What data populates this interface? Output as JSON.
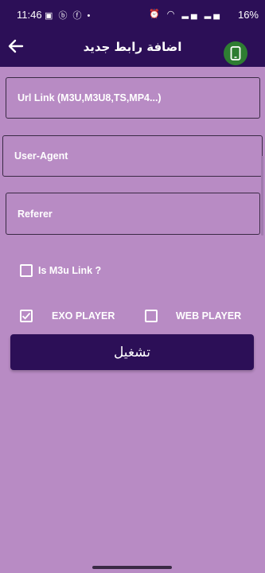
{
  "status_bar": {
    "time": "11:46",
    "battery": "16%",
    "left_icons": [
      "screenshot-icon",
      "b-icon",
      "facebook-icon",
      "dot-icon"
    ],
    "right_icons": [
      "alarm-icon",
      "wifi-icon",
      "signal-icon",
      "signal-icon"
    ]
  },
  "app_bar": {
    "title": "اضافة رابط جديد"
  },
  "form": {
    "url_placeholder": "Url Link (M3U,M3U8,TS,MP4...)",
    "user_agent_placeholder": "User-Agent",
    "referer_placeholder": "Referer",
    "is_m3u_label": "Is M3u Link ?",
    "is_m3u_checked": false,
    "exo_label": "EXO PLAYER",
    "exo_checked": true,
    "web_label": "WEB PLAYER",
    "web_checked": false,
    "run_label": "تشغيل"
  },
  "colors": {
    "primary": "#2c0f57",
    "background": "#b88bc4",
    "accent_green": "#2e7d32"
  }
}
